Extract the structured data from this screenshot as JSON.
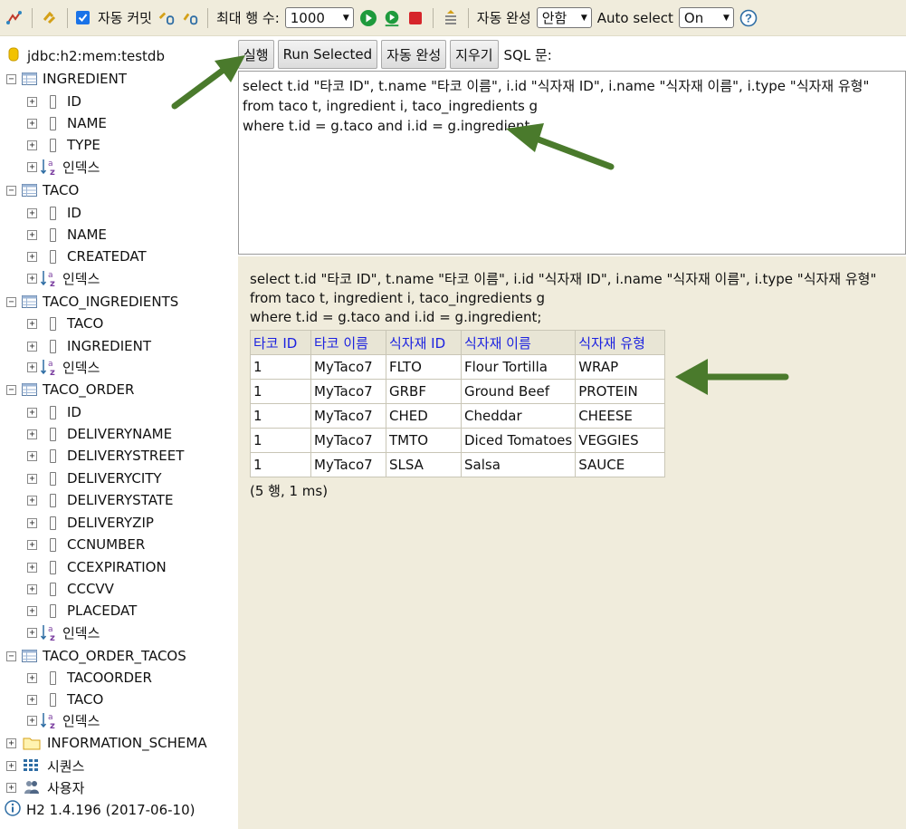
{
  "toolbar": {
    "autocommit_label": "자동 커밋",
    "maxrows_label": "최대 행 수:",
    "maxrows_value": "1000",
    "autocomplete_label": "자동 완성",
    "autocomplete_value": "안함",
    "autoselect_label": "Auto select",
    "autoselect_value": "On",
    "help_glyph": "?"
  },
  "tree": {
    "connection": "jdbc:h2:mem:testdb",
    "index_label": "인덱스",
    "tables": [
      {
        "name": "INGREDIENT",
        "columns": [
          "ID",
          "NAME",
          "TYPE"
        ]
      },
      {
        "name": "TACO",
        "columns": [
          "ID",
          "NAME",
          "CREATEDAT"
        ]
      },
      {
        "name": "TACO_INGREDIENTS",
        "columns": [
          "TACO",
          "INGREDIENT"
        ]
      },
      {
        "name": "TACO_ORDER",
        "columns": [
          "ID",
          "DELIVERYNAME",
          "DELIVERYSTREET",
          "DELIVERYCITY",
          "DELIVERYSTATE",
          "DELIVERYZIP",
          "CCNUMBER",
          "CCEXPIRATION",
          "CCCVV",
          "PLACEDAT"
        ]
      },
      {
        "name": "TACO_ORDER_TACOS",
        "columns": [
          "TACOORDER",
          "TACO"
        ]
      }
    ],
    "info_schema": "INFORMATION_SCHEMA",
    "sequences": "시퀀스",
    "users": "사용자",
    "version": "H2 1.4.196 (2017-06-10)"
  },
  "buttons": {
    "run": "실행",
    "run_selected": "Run Selected",
    "autocomplete": "자동 완성",
    "clear": "지우기",
    "sql_label": "SQL 문:"
  },
  "editor": {
    "lines": [
      "select t.id \"타코 ID\", t.name \"타코 이름\", i.id \"식자재 ID\", i.name \"식자재 이름\", i.type \"식자재 유형\"",
      "from taco t, ingredient i, taco_ingredients g",
      "where t.id = g.taco and i.id = g.ingredient"
    ]
  },
  "result": {
    "sql_lines": [
      "select t.id \"타코 ID\", t.name \"타코 이름\", i.id \"식자재 ID\", i.name \"식자재 이름\", i.type \"식자재 유형\"",
      "from taco t, ingredient i, taco_ingredients g",
      "where t.id = g.taco and i.id = g.ingredient;"
    ],
    "headers": [
      "타코 ID",
      "타코 이름",
      "식자재 ID",
      "식자재 이름",
      "식자재 유형"
    ],
    "rows": [
      [
        "1",
        "MyTaco7",
        "FLTO",
        "Flour Tortilla",
        "WRAP"
      ],
      [
        "1",
        "MyTaco7",
        "GRBF",
        "Ground Beef",
        "PROTEIN"
      ],
      [
        "1",
        "MyTaco7",
        "CHED",
        "Cheddar",
        "CHEESE"
      ],
      [
        "1",
        "MyTaco7",
        "TMTO",
        "Diced Tomatoes",
        "VEGGIES"
      ],
      [
        "1",
        "MyTaco7",
        "SLSA",
        "Salsa",
        "SAUCE"
      ]
    ],
    "rowinfo": "(5 행, 1 ms)"
  },
  "colors": {
    "panel_bg": "#f0ecdc",
    "header_text": "#1c22e0",
    "arrow_green": "#4a7a2c"
  }
}
